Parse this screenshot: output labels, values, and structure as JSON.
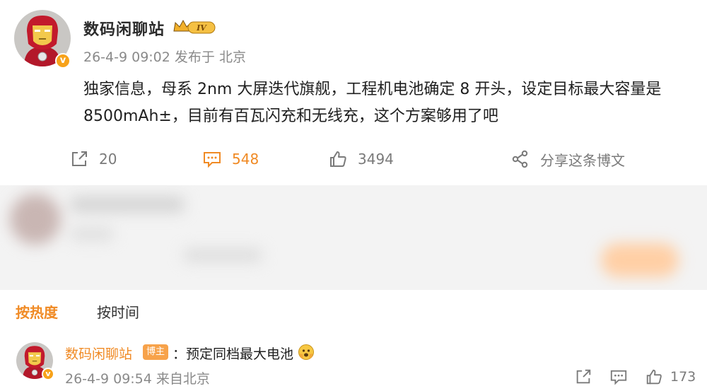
{
  "post": {
    "author": "数码闲聊站",
    "level_badge": "IV",
    "meta": "26-4-9 09:02 发布于 北京",
    "content": "独家信息，母系 2nm 大屏迭代旗舰，工程机电池确定 8 开头，设定目标最大容量是 8500mAh±，目前有百瓦闪充和无线充，这个方案够用了吧",
    "verified_badge": "v"
  },
  "actions": {
    "share_count": "20",
    "comment_count": "548",
    "like_count": "3494",
    "share_text": "分享这条博文"
  },
  "sort_tabs": {
    "hot": "按热度",
    "time": "按时间"
  },
  "comment": {
    "author": "数码闲聊站",
    "tag": "博主",
    "text": "：预定同档最大电池",
    "meta": "26-4-9 09:54 来自北京",
    "like_count": "173"
  },
  "colors": {
    "accent": "#f08a24",
    "gray_text": "#8a8a8a",
    "verified": "#f7a21a"
  },
  "icons": [
    "crown-icon",
    "share-icon",
    "comment-icon",
    "like-icon",
    "share-network-icon",
    "emoji-icon"
  ]
}
